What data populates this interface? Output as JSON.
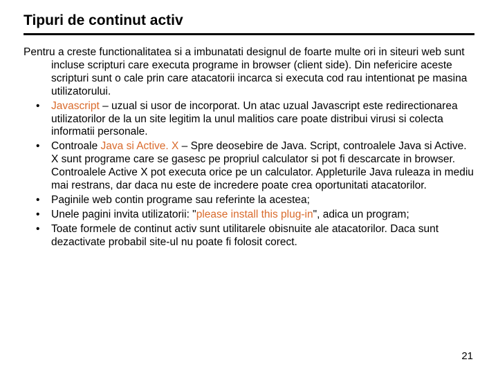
{
  "title": "Tipuri de continut activ",
  "intro": "Pentru a creste functionalitatea si a imbunatati designul de foarte multe ori in siteuri web sunt incluse scripturi care executa programe in browser (client side). Din nefericire aceste scripturi sunt o cale prin care atacatorii incarca si executa cod rau intentionat pe masina utilizatorului.",
  "b1_kw": "Javascript",
  "b1_rest": " – uzual si usor de incorporat. Un atac uzual Javascript este redirectionarea utilizatorilor de la un site legitim la unul malitios care poate distribui virusi si colecta informatii personale.",
  "b2_pre": "Controale ",
  "b2_kw": "Java si Active. X",
  "b2_rest": " – Spre deosebire de Java. Script, controalele Java si Active. X sunt programe care se gasesc pe propriul calculator si pot fi descarcate in browser. Controalele Active X pot executa orice pe un calculator. Appleturile Java ruleaza in mediu mai restrans, dar daca nu este de incredere poate crea oportunitati atacatorilor.",
  "b3": "Paginile web contin programe sau referinte la acestea;",
  "b4_pre": "Unele pagini invita utilizatorii: \"",
  "b4_kw": "please install this plug-in",
  "b4_post": "\", adica un program;",
  "b5": "Toate formele de continut activ sunt utilitarele obisnuite ale atacatorilor. Daca sunt dezactivate probabil site-ul nu poate fi folosit corect.",
  "page_number": "21"
}
